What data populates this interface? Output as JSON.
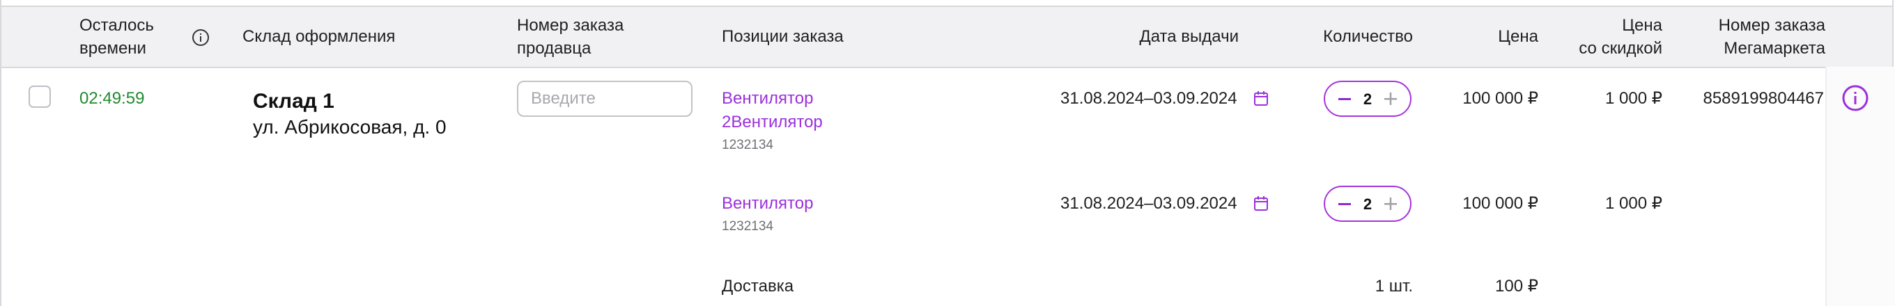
{
  "header": {
    "time_left_line1": "Осталось",
    "time_left_line2": "времени",
    "warehouse": "Склад оформления",
    "seller_order_line1": "Номер заказа",
    "seller_order_line2": "продавца",
    "positions": "Позиции заказа",
    "issue_date": "Дата выдачи",
    "quantity": "Количество",
    "price": "Цена",
    "discount_price_line1": "Цена",
    "discount_price_line2": "со скидкой",
    "mm_order_line1": "Номер заказа",
    "mm_order_line2": "Мегамаркета"
  },
  "order": {
    "timer": "02:49:59",
    "warehouse_title": "Склад 1",
    "warehouse_address": "ул. Абрикосовая, д. 0",
    "seller_order_placeholder": "Введите",
    "mm_order_number": "8589199804467",
    "items": [
      {
        "name_line1": "Вентилятор",
        "name_line2": "2Вентилятор",
        "sku": "1232134",
        "date": "31.08.2024–03.09.2024",
        "qty": "2",
        "price": "100 000 ₽",
        "discount_price": "1 000 ₽"
      },
      {
        "name_line1": "Вентилятор",
        "sku": "1232134",
        "date": "31.08.2024–03.09.2024",
        "qty": "2",
        "price": "100 000 ₽",
        "discount_price": "1 000 ₽"
      }
    ],
    "delivery": {
      "label": "Доставка",
      "qty": "1 шт.",
      "price": "100 ₽"
    }
  },
  "colors": {
    "accent": "#9b2fdb",
    "timer": "#1f8a2e",
    "header_bg": "#f1f1f4"
  }
}
